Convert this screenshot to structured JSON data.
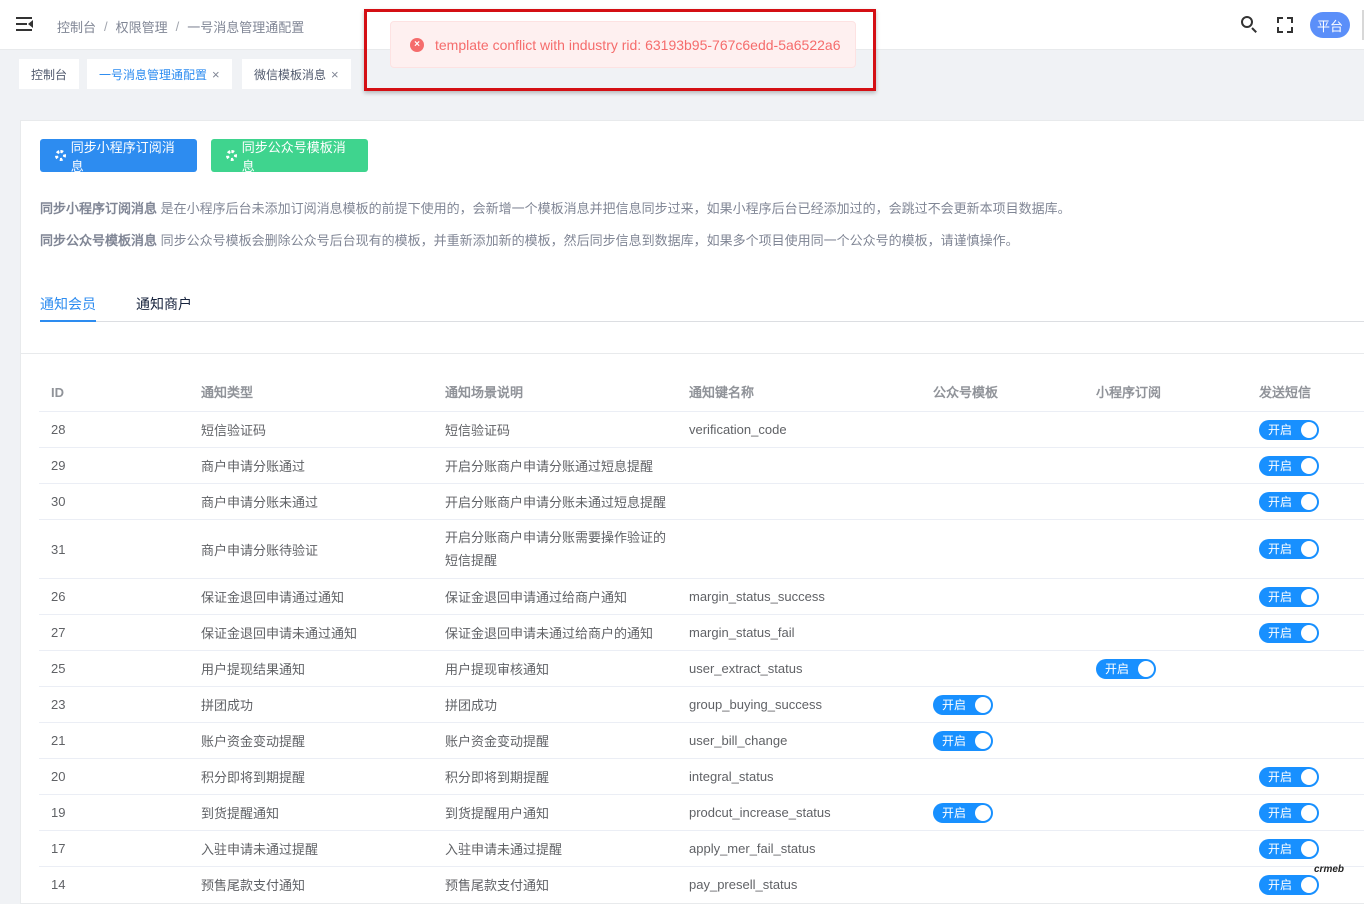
{
  "header": {
    "breadcrumb": [
      "控制台",
      "权限管理",
      "一号消息管理通配置"
    ],
    "avatar_label": "平台"
  },
  "tags": [
    {
      "label": "控制台",
      "closable": false,
      "active": false
    },
    {
      "label": "一号消息管理通配置",
      "closable": true,
      "active": true
    },
    {
      "label": "微信模板消息",
      "closable": true,
      "active": false
    }
  ],
  "toast": {
    "message": "template conflict with industry rid: 63193b95-767c6edd-5a6522a6",
    "color": "#f56c6c"
  },
  "actions": {
    "sync_miniprogram": "同步小程序订阅消息",
    "sync_official": "同步公众号模板消息"
  },
  "notes": {
    "note1_title": "同步小程序订阅消息",
    "note1_text": " 是在小程序后台未添加订阅消息模板的前提下使用的，会新增一个模板消息并把信息同步过来，如果小程序后台已经添加过的，会跳过不会更新本项目数据库。",
    "note2_title": "同步公众号模板消息",
    "note2_text": " 同步公众号模板会删除公众号后台现有的模板，并重新添加新的模板，然后同步信息到数据库，如果多个项目使用同一个公众号的模板，请谨慎操作。"
  },
  "subtabs": [
    "通知会员",
    "通知商户"
  ],
  "table": {
    "columns": [
      "ID",
      "通知类型",
      "通知场景说明",
      "通知键名称",
      "公众号模板",
      "小程序订阅",
      "发送短信"
    ],
    "switch_label": "开启",
    "rows": [
      {
        "id": "28",
        "type": "短信验证码",
        "desc": "短信验证码",
        "key": "verification_code",
        "wechat": false,
        "routine": false,
        "sms": true
      },
      {
        "id": "29",
        "type": "商户申请分账通过",
        "desc": "开启分账商户申请分账通过短息提醒",
        "key": "",
        "wechat": false,
        "routine": false,
        "sms": true
      },
      {
        "id": "30",
        "type": "商户申请分账未通过",
        "desc": "开启分账商户申请分账未通过短息提醒",
        "key": "",
        "wechat": false,
        "routine": false,
        "sms": true
      },
      {
        "id": "31",
        "type": "商户申请分账待验证",
        "desc": "开启分账商户申请分账需要操作验证的短信提醒",
        "key": "",
        "wechat": false,
        "routine": false,
        "sms": true
      },
      {
        "id": "26",
        "type": "保证金退回申请通过通知",
        "desc": "保证金退回申请通过给商户通知",
        "key": "margin_status_success",
        "wechat": false,
        "routine": false,
        "sms": true
      },
      {
        "id": "27",
        "type": "保证金退回申请未通过通知",
        "desc": "保证金退回申请未通过给商户的通知",
        "key": "margin_status_fail",
        "wechat": false,
        "routine": false,
        "sms": true
      },
      {
        "id": "25",
        "type": "用户提现结果通知",
        "desc": "用户提现审核通知",
        "key": "user_extract_status",
        "wechat": false,
        "routine": true,
        "sms": false
      },
      {
        "id": "23",
        "type": "拼团成功",
        "desc": "拼团成功",
        "key": "group_buying_success",
        "wechat": true,
        "routine": false,
        "sms": false
      },
      {
        "id": "21",
        "type": "账户资金变动提醒",
        "desc": "账户资金变动提醒",
        "key": "user_bill_change",
        "wechat": true,
        "routine": false,
        "sms": false
      },
      {
        "id": "20",
        "type": "积分即将到期提醒",
        "desc": "积分即将到期提醒",
        "key": "integral_status",
        "wechat": false,
        "routine": false,
        "sms": true
      },
      {
        "id": "19",
        "type": "到货提醒通知",
        "desc": "到货提醒用户通知",
        "key": "prodcut_increase_status",
        "wechat": true,
        "routine": false,
        "sms": true
      },
      {
        "id": "17",
        "type": "入驻申请未通过提醒",
        "desc": "入驻申请未通过提醒",
        "key": "apply_mer_fail_status",
        "wechat": false,
        "routine": false,
        "sms": true
      },
      {
        "id": "14",
        "type": "预售尾款支付通知",
        "desc": "预售尾款支付通知",
        "key": "pay_presell_status",
        "wechat": false,
        "routine": false,
        "sms": true
      }
    ]
  },
  "brand_logo": "crmeb",
  "colors": {
    "primary": "#2d8cf0",
    "switch_on": "#1890ff",
    "success": "#3fd48e",
    "error": "#f56c6c"
  }
}
